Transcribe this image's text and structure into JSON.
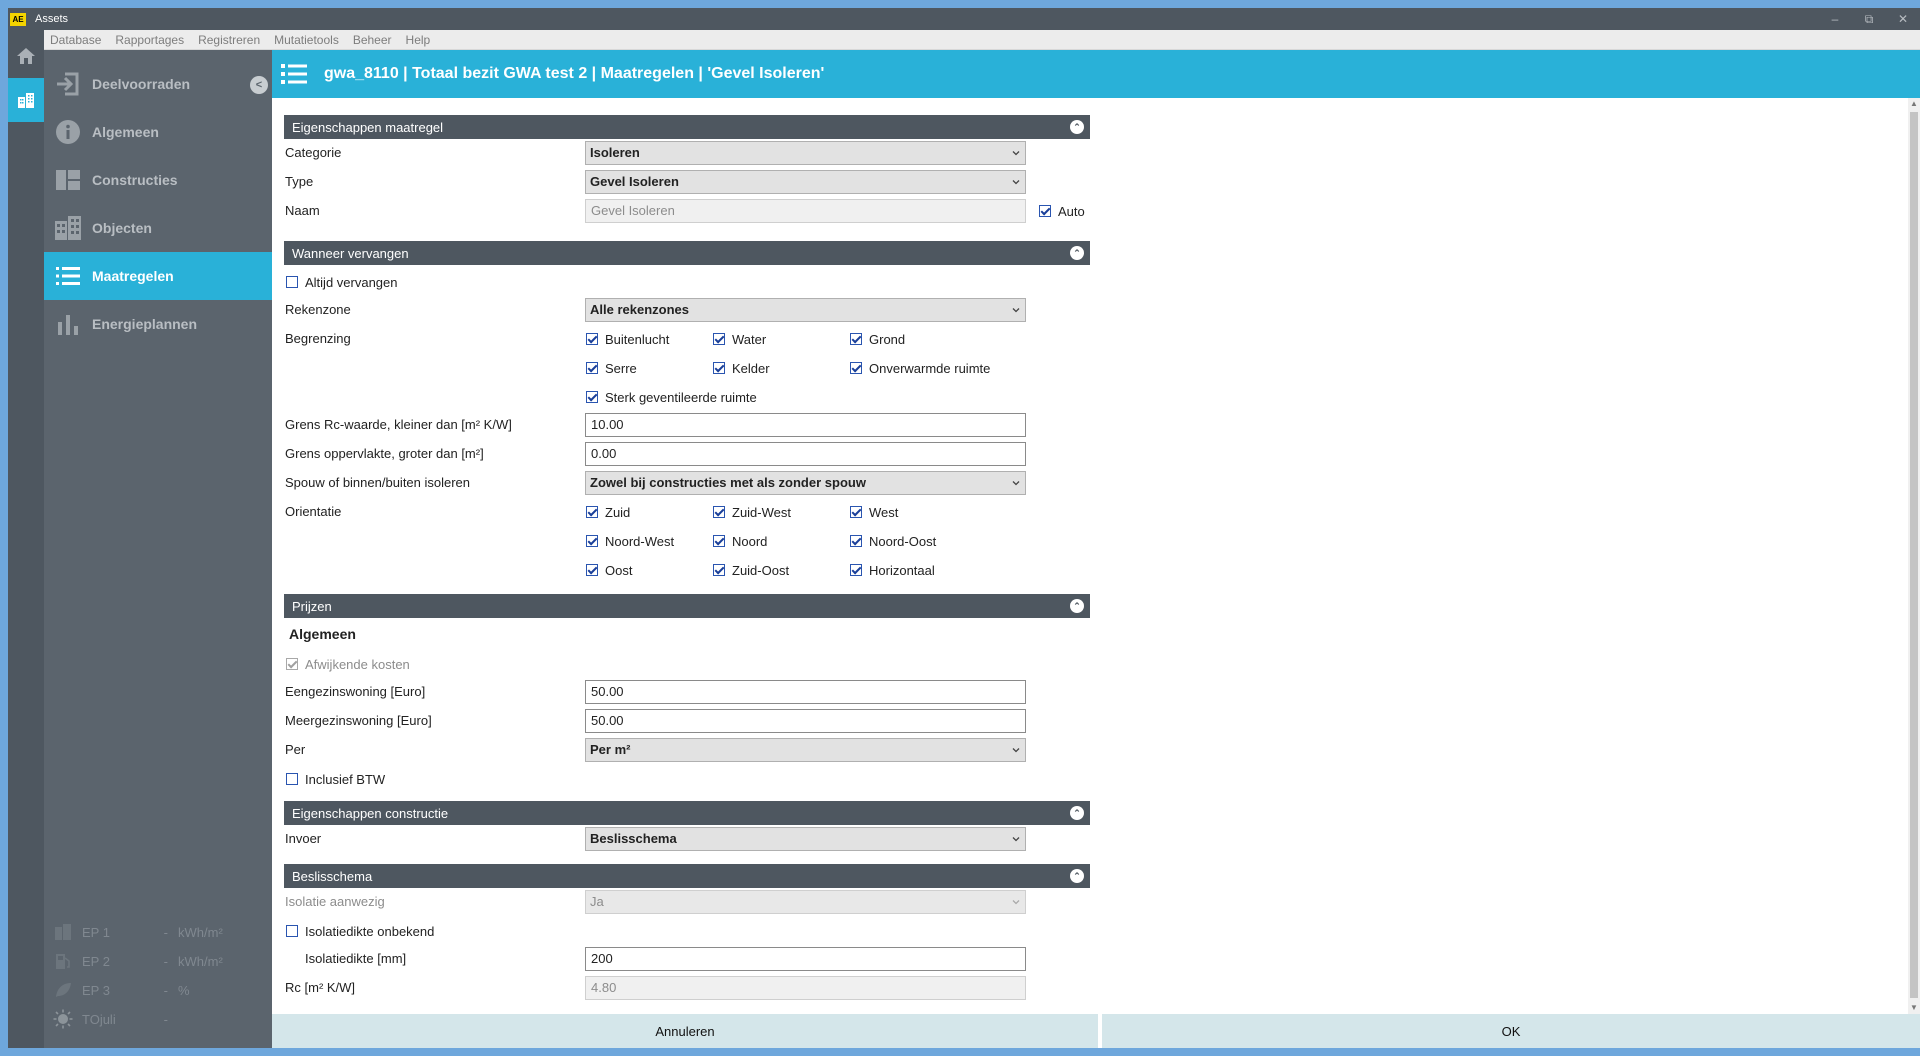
{
  "window": {
    "badge": "AE",
    "title": "Assets",
    "controls": {
      "minimize": "–",
      "restore": "⧉",
      "close": "✕"
    }
  },
  "menubar": [
    "Database",
    "Rapportages",
    "Registreren",
    "Mutatietools",
    "Beheer",
    "Help"
  ],
  "sidebar": {
    "collapse": "<",
    "items": [
      {
        "label": "Deelvoorraden",
        "icon": "sign-in-icon"
      },
      {
        "label": "Algemeen",
        "icon": "info-icon"
      },
      {
        "label": "Constructies",
        "icon": "layout-icon"
      },
      {
        "label": "Objecten",
        "icon": "building-icon"
      },
      {
        "label": "Maatregelen",
        "icon": "list-icon"
      },
      {
        "label": "Energieplannen",
        "icon": "bar-chart-icon"
      }
    ],
    "active_index": 4,
    "indicators": [
      {
        "label": "EP 1",
        "value": "-",
        "unit": "kWh/m²",
        "icon": "building-icon"
      },
      {
        "label": "EP 2",
        "value": "-",
        "unit": "kWh/m²",
        "icon": "fuel-icon"
      },
      {
        "label": "EP 3",
        "value": "-",
        "unit": "%",
        "icon": "leaf-icon"
      },
      {
        "label": "TOjuli",
        "value": "-",
        "unit": "",
        "icon": "sun-icon"
      }
    ]
  },
  "header": {
    "title": "gwa_8110 | Totaal bezit GWA test 2 | Maatregelen | 'Gevel Isoleren'"
  },
  "sections": {
    "eigenschappen_maatregel": "Eigenschappen maatregel",
    "wanneer_vervangen": "Wanneer vervangen",
    "prijzen": "Prijzen",
    "eigenschappen_constructie": "Eigenschappen constructie",
    "beslisschema": "Beslisschema"
  },
  "maatregel": {
    "categorie_label": "Categorie",
    "categorie_value": "Isoleren",
    "type_label": "Type",
    "type_value": "Gevel Isoleren",
    "naam_label": "Naam",
    "naam_value": "Gevel Isoleren",
    "auto_label": "Auto",
    "auto_checked": true
  },
  "vervangen": {
    "altijd_label": "Altijd vervangen",
    "altijd_checked": false,
    "rekenzone_label": "Rekenzone",
    "rekenzone_value": "Alle rekenzones",
    "begrenzing_label": "Begrenzing",
    "begrenzing": [
      {
        "label": "Buitenlucht",
        "checked": true
      },
      {
        "label": "Water",
        "checked": true
      },
      {
        "label": "Grond",
        "checked": true
      },
      {
        "label": "Serre",
        "checked": true
      },
      {
        "label": "Kelder",
        "checked": true
      },
      {
        "label": "Onverwarmde ruimte",
        "checked": true
      },
      {
        "label": "Sterk geventileerde ruimte",
        "checked": true
      }
    ],
    "rc_label": "Grens Rc-waarde, kleiner dan [m² K/W]",
    "rc_value": "10.00",
    "opp_label": "Grens oppervlakte, groter dan [m²]",
    "opp_value": "0.00",
    "spouw_label": "Spouw of binnen/buiten isoleren",
    "spouw_value": "Zowel bij constructies met als zonder spouw",
    "orientatie_label": "Orientatie",
    "orientatie": [
      {
        "label": "Zuid",
        "checked": true
      },
      {
        "label": "Zuid-West",
        "checked": true
      },
      {
        "label": "West",
        "checked": true
      },
      {
        "label": "Noord-West",
        "checked": true
      },
      {
        "label": "Noord",
        "checked": true
      },
      {
        "label": "Noord-Oost",
        "checked": true
      },
      {
        "label": "Oost",
        "checked": true
      },
      {
        "label": "Zuid-Oost",
        "checked": true
      },
      {
        "label": "Horizontaal",
        "checked": true
      }
    ]
  },
  "prijzen": {
    "subhead": "Algemeen",
    "afwijkend_label": "Afwijkende kosten",
    "afwijkend_checked": true,
    "eengezins_label": "Eengezinswoning [Euro]",
    "eengezins_value": "50.00",
    "meergezins_label": "Meergezinswoning [Euro]",
    "meergezins_value": "50.00",
    "per_label": "Per",
    "per_value": "Per m²",
    "btw_label": "Inclusief BTW",
    "btw_checked": false
  },
  "constructie": {
    "invoer_label": "Invoer",
    "invoer_value": "Beslisschema"
  },
  "beslis": {
    "isolatie_label": "Isolatie aanwezig",
    "isolatie_value": "Ja",
    "onbekend_label": "Isolatiedikte onbekend",
    "onbekend_checked": false,
    "dikte_label": "Isolatiedikte [mm]",
    "dikte_value": "200",
    "rc_label": "Rc [m² K/W]",
    "rc_value": "4.80"
  },
  "footer": {
    "cancel": "Annuleren",
    "ok": "OK"
  }
}
